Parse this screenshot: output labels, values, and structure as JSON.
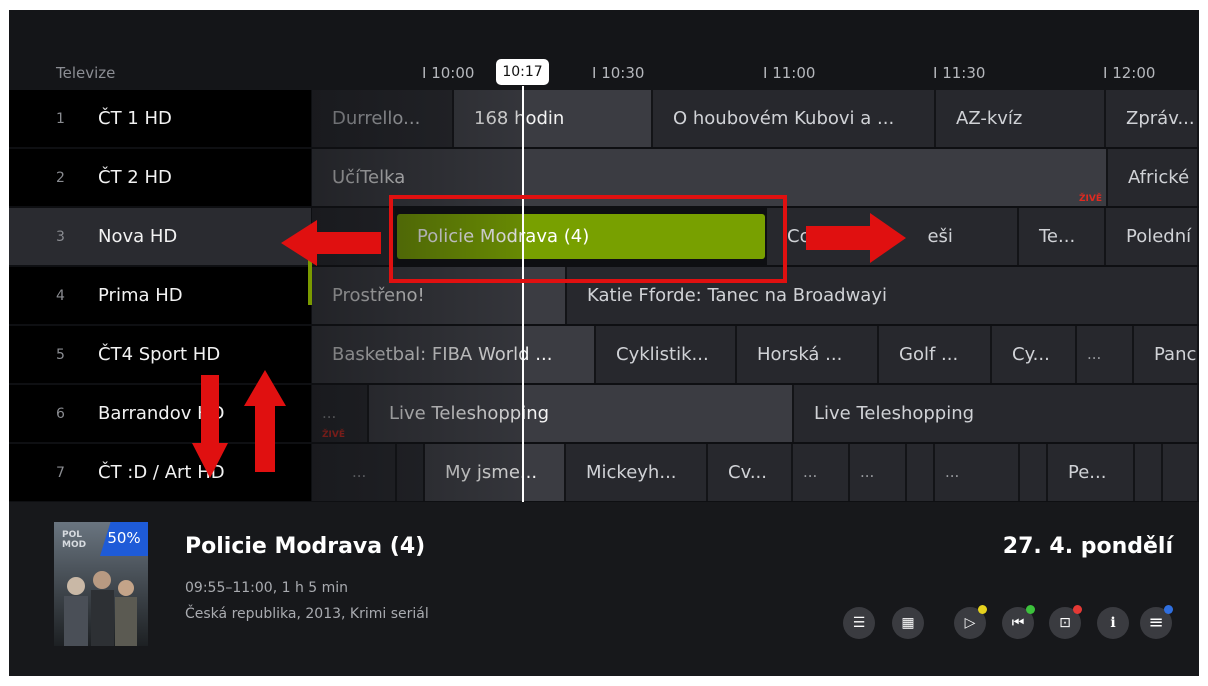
{
  "header": {
    "section_label": "Televize",
    "ticks": [
      "I 10:00",
      "I 10:30",
      "I 11:00",
      "I 11:30",
      "I 12:00"
    ],
    "now_time": "10:17"
  },
  "channels": [
    {
      "number": "1",
      "name": "ČT 1 HD"
    },
    {
      "number": "2",
      "name": "ČT 2 HD"
    },
    {
      "number": "3",
      "name": "Nova HD"
    },
    {
      "number": "4",
      "name": "Prima HD"
    },
    {
      "number": "5",
      "name": "ČT4 Sport HD"
    },
    {
      "number": "6",
      "name": "Barrandov HD"
    },
    {
      "number": "7",
      "name": "ČT :D / Art HD"
    }
  ],
  "grid": {
    "row1": [
      "Durrello...",
      "168 hodin",
      "O houbovém Kubovi a ...",
      "AZ-kvíz",
      "Zpráv..."
    ],
    "row2": [
      "UčíTelka",
      "Africké"
    ],
    "row3": [
      "Policie Modrava (4)",
      "Co...",
      "eši",
      "Te...",
      "Polední"
    ],
    "row4": [
      "Prostřeno!",
      "Katie Fforde: Tanec na Broadwayi"
    ],
    "row5": [
      "Basketbal: FIBA World ...",
      "Cyklistik...",
      "Horská ...",
      "Golf ...",
      "Cy...",
      "...",
      "Panc"
    ],
    "row6": [
      "...",
      "Live Teleshopping",
      "Live Teleshopping"
    ],
    "row7": [
      "...",
      "My jsme...",
      "Mickeyh...",
      "Cv...",
      "...",
      "...",
      "...",
      "Pe..."
    ],
    "live_tag": "ŽIVĚ"
  },
  "detail": {
    "poster_title": "POL MOD",
    "watched_badge": "50%",
    "title": "Policie Modrava (4)",
    "time": "09:55–11:00, 1 h 5 min",
    "meta": "Česká republika, 2013, Krimi seriál",
    "date": "27. 4. pondělí"
  },
  "controls": [
    {
      "icon": "list-icon",
      "glyph": "☰"
    },
    {
      "icon": "calendar-icon",
      "glyph": "▦"
    },
    {
      "icon": "play-icon",
      "glyph": "▷",
      "dot": "#e6d21e"
    },
    {
      "icon": "restart-icon",
      "glyph": "⏮",
      "dot": "#3cc23c"
    },
    {
      "icon": "record-icon",
      "glyph": "⊡",
      "dot": "#e53935"
    },
    {
      "icon": "info-icon",
      "glyph": "i"
    },
    {
      "icon": "menu-icon",
      "glyph": "≡",
      "dot": "#2f6fe0"
    }
  ],
  "colors": {
    "focus": "#78a000",
    "annotation": "#e01010",
    "live": "#e02a20"
  }
}
